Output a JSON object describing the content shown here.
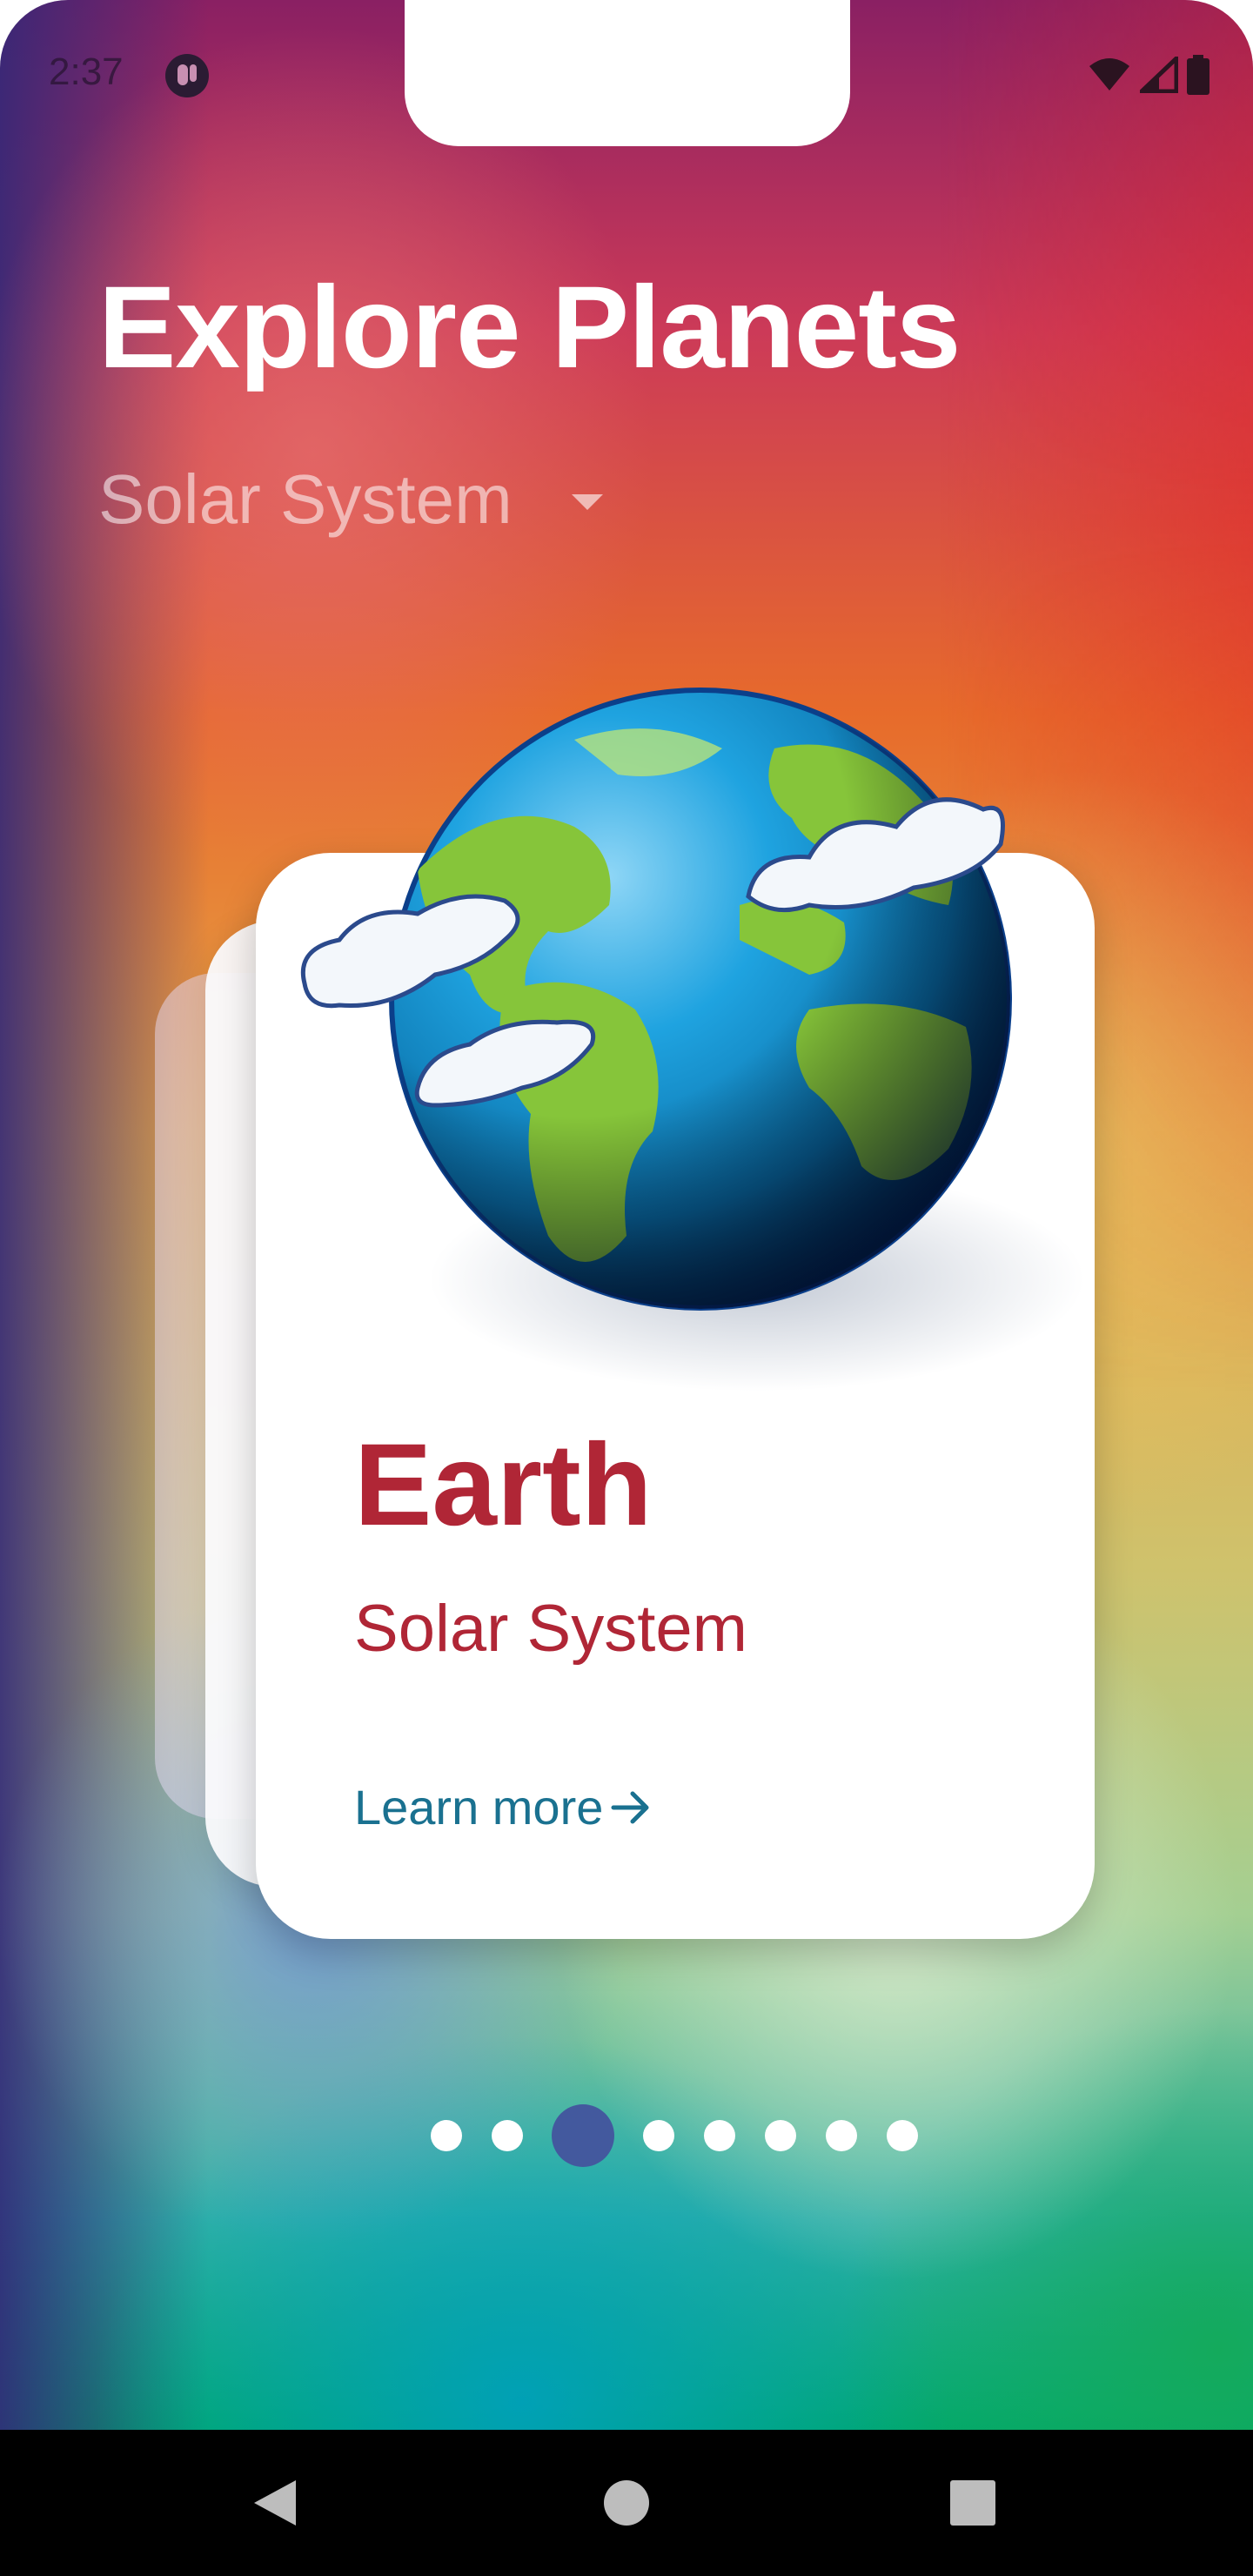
{
  "status_bar": {
    "time": "2:37",
    "icons": [
      "notification-app-icon",
      "wifi-icon",
      "signal-icon",
      "battery-icon"
    ]
  },
  "header": {
    "title": "Explore Planets",
    "system_selector": {
      "selected": "Solar System",
      "icon": "caret-down-icon"
    }
  },
  "card": {
    "planet_image": "earth-illustration",
    "planet_name": "Earth",
    "system": "Solar System",
    "learn_more_label": "Learn more",
    "learn_more_icon": "arrow-right-icon"
  },
  "pager": {
    "count": 8,
    "active_index": 2
  },
  "colors": {
    "title": "#ffffff",
    "planet_name": "#b02636",
    "link": "#1a7190",
    "active_dot": "#43599e",
    "dot": "#ffffff",
    "nav_bar": "#000000"
  },
  "nav_bar": {
    "buttons": [
      "back-icon",
      "home-icon",
      "recents-icon"
    ]
  }
}
